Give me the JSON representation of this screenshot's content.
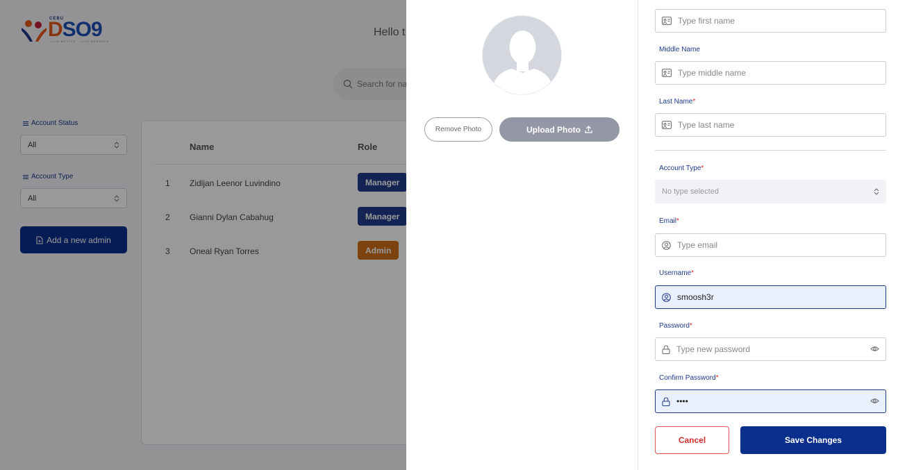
{
  "logo": {
    "top_text": "CEBU",
    "main_text_d": "D",
    "main_text_rest": "SO9",
    "tagline": "LIVE BETTER · LIVE GREENER"
  },
  "header": {
    "greeting": "Hello t",
    "search_placeholder": "Search for na"
  },
  "filters": {
    "status_label": "Account Status",
    "status_value": "All",
    "type_label": "Account Type",
    "type_value": "All",
    "add_admin_label": "Add a new admin"
  },
  "table": {
    "columns": [
      "Name",
      "Role"
    ],
    "rows": [
      {
        "num": "1",
        "name": "Zidljan Leenor Luvindino",
        "role": "Manager"
      },
      {
        "num": "2",
        "name": "Gianni Dylan Cabahug",
        "role": "Manager"
      },
      {
        "num": "3",
        "name": "Oneal Ryan Torres",
        "role": "Admin"
      }
    ]
  },
  "colors": {
    "primary": "#0a2f8c",
    "manager_badge": "#1f3b8c",
    "admin_badge": "#d0701a",
    "required": "#e02424"
  },
  "photo": {
    "remove_label": "Remove Photo",
    "upload_label": "Upload Photo"
  },
  "form": {
    "first_name": {
      "placeholder": "Type first name"
    },
    "middle_name": {
      "label": "Middle Name",
      "placeholder": "Type middle name"
    },
    "last_name": {
      "label": "Last Name",
      "placeholder": "Type last name"
    },
    "account_type": {
      "label": "Account Type",
      "value": "No type selected"
    },
    "email": {
      "label": "Email",
      "placeholder": "Type email"
    },
    "username": {
      "label": "Username",
      "value": "smoosh3r"
    },
    "password": {
      "label": "Password",
      "placeholder": "Type new password"
    },
    "confirm_password": {
      "label": "Confirm Password",
      "value": "••••"
    },
    "required_mark": "*",
    "cancel_label": "Cancel",
    "save_label": "Save Changes"
  }
}
